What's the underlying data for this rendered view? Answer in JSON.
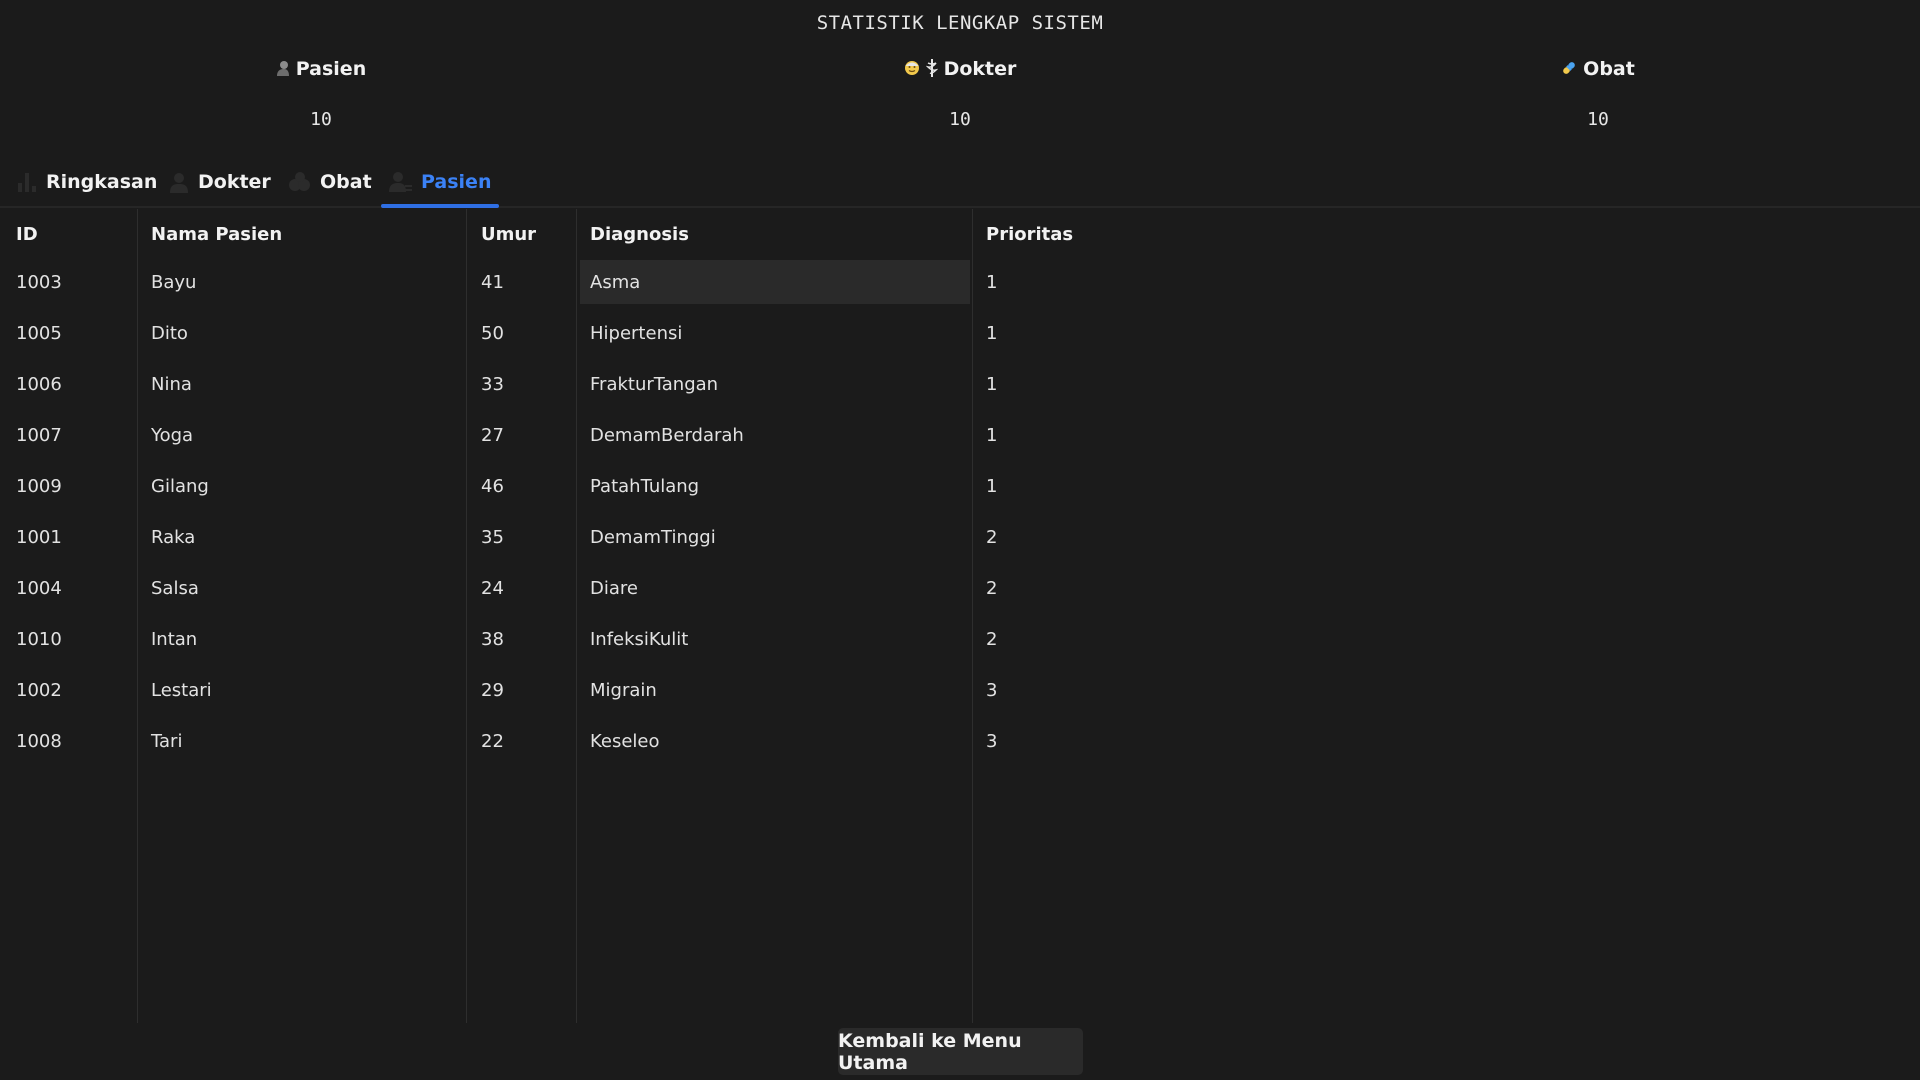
{
  "title": "STATISTIK LENGKAP SISTEM",
  "stats": [
    {
      "label": "Pasien",
      "value": "10",
      "icon": "person-icon"
    },
    {
      "label": "Dokter",
      "value": "10",
      "icon": "doctor-medical-icon"
    },
    {
      "label": "Obat",
      "value": "10",
      "icon": "pill-icon"
    }
  ],
  "tabs": [
    {
      "label": "Ringkasan",
      "icon": "bar-chart-icon",
      "active": false
    },
    {
      "label": "Dokter",
      "icon": "person-icon",
      "active": false
    },
    {
      "label": "Obat",
      "icon": "pills-icon",
      "active": false
    },
    {
      "label": "Pasien",
      "icon": "user-list-icon",
      "active": true
    }
  ],
  "table": {
    "columns": [
      "ID",
      "Nama Pasien",
      "Umur",
      "Diagnosis",
      "Prioritas"
    ],
    "rows": [
      [
        "1003",
        "Bayu",
        "41",
        "Asma",
        "1"
      ],
      [
        "1005",
        "Dito",
        "50",
        "Hipertensi",
        "1"
      ],
      [
        "1006",
        "Nina",
        "33",
        "FrakturTangan",
        "1"
      ],
      [
        "1007",
        "Yoga",
        "27",
        "DemamBerdarah",
        "1"
      ],
      [
        "1009",
        "Gilang",
        "46",
        "PatahTulang",
        "1"
      ],
      [
        "1001",
        "Raka",
        "35",
        "DemamTinggi",
        "2"
      ],
      [
        "1004",
        "Salsa",
        "24",
        "Diare",
        "2"
      ],
      [
        "1010",
        "Intan",
        "38",
        "InfeksiKulit",
        "2"
      ],
      [
        "1002",
        "Lestari",
        "29",
        "Migrain",
        "3"
      ],
      [
        "1008",
        "Tari",
        "22",
        "Keseleo",
        "3"
      ]
    ]
  },
  "footer": {
    "back_label": "Kembali ke Menu Utama"
  },
  "colors": {
    "accent": "#3b82f6",
    "background": "#1b1b1b",
    "selected_cell": "#2a2a2a"
  }
}
